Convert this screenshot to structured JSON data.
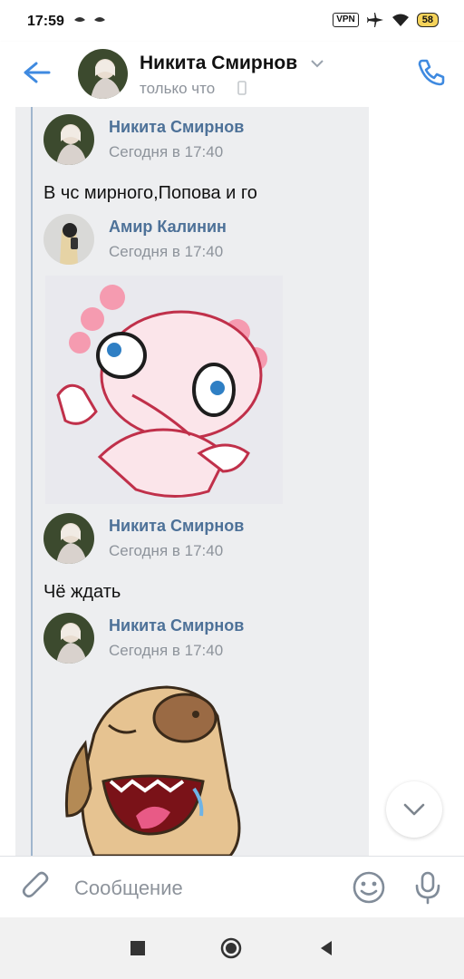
{
  "status_bar": {
    "time": "17:59",
    "vpn": "VPN",
    "battery": "58",
    "icons": [
      "notification-icon",
      "notification-icon",
      "airplane-icon",
      "wifi-icon"
    ]
  },
  "header": {
    "name": "Никита Смирнов",
    "status": "только что",
    "icons": [
      "back-arrow-icon",
      "chevron-down-icon",
      "mobile-phone-icon",
      "phone-call-icon"
    ],
    "accent_color": "#3f8ae0"
  },
  "messages": [
    {
      "author": "Никита Смирнов",
      "time": "Сегодня в 17:40",
      "text": "В чс мирного,Попова и го"
    },
    {
      "author": "Амир Калинин",
      "time": "Сегодня в 17:40",
      "sticker": "axolotl-sticker"
    },
    {
      "author": "Никита Смирнов",
      "time": "Сегодня в 17:40",
      "text": "Чё ждать"
    },
    {
      "author": "Никита Смирнов",
      "time": "Сегодня в 17:40",
      "sticker": "dog-laughing-sticker"
    }
  ],
  "composer": {
    "placeholder": "Сообщение",
    "icons": [
      "attach-icon",
      "emoji-icon",
      "microphone-icon"
    ]
  },
  "colors": {
    "author_name": "#4d7198",
    "forward_bg": "#edeef0",
    "forward_line": "#9fb5cd",
    "muted_text": "#8d939b"
  },
  "nav_bar": {
    "icons": [
      "recents-square-icon",
      "home-circle-icon",
      "back-triangle-icon"
    ]
  }
}
